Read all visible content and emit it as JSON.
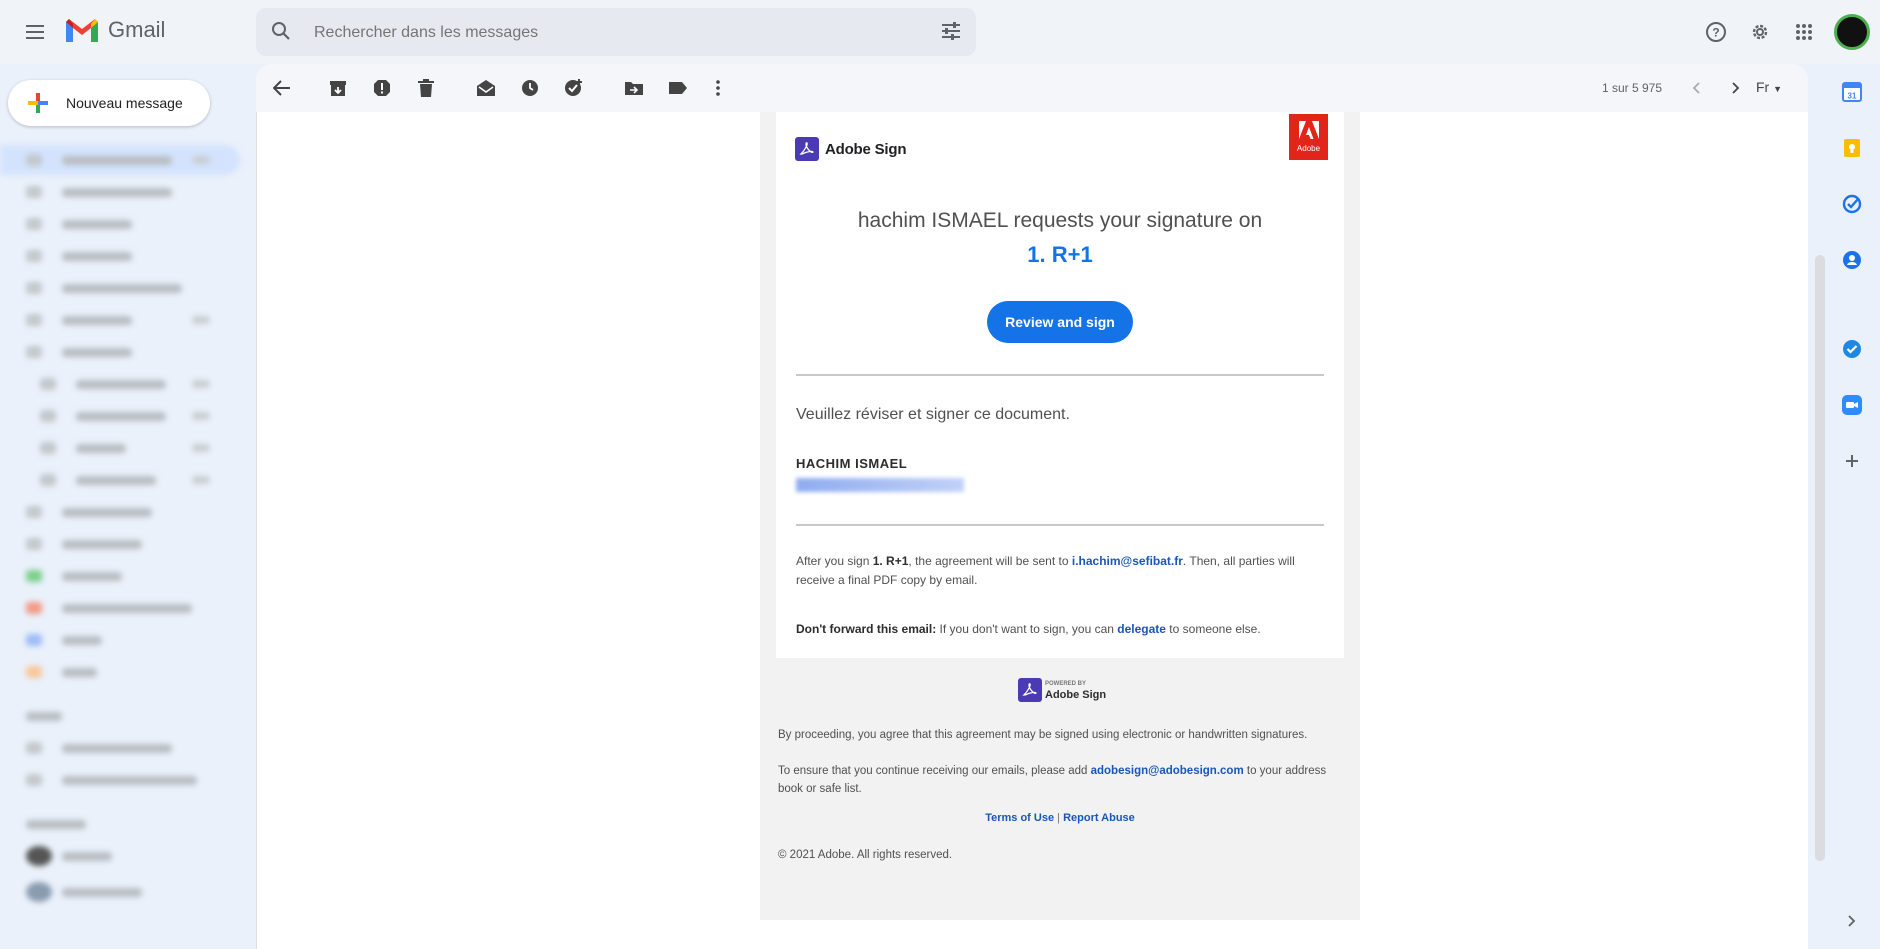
{
  "app": {
    "name": "Gmail"
  },
  "search": {
    "placeholder": "Rechercher dans les messages"
  },
  "compose": {
    "label": "Nouveau message"
  },
  "toolbar": {
    "pager": "1 sur 5 975",
    "lang": "Fr"
  },
  "email": {
    "brand": "Adobe Sign",
    "badge_text": "Adobe",
    "request_line": "hachim ISMAEL requests your signature on",
    "document_name": "1. R+1",
    "review_button": "Review and sign",
    "message": "Veuillez réviser et signer ce document.",
    "sender_name": "HACHIM ISMAEL",
    "after_prefix": "After you sign ",
    "after_doc": "1. R+1",
    "after_mid": ", the agreement will be sent to ",
    "after_email": "i.hachim@sefibat.fr",
    "after_suffix": ". Then, all parties will receive a final PDF copy by email.",
    "dont_forward_label": "Don't forward this email:",
    "dont_forward_text": " If you don't want to sign, you can ",
    "delegate_link": "delegate",
    "dont_forward_end": " to someone else."
  },
  "footer": {
    "powered_by": "POWERED BY",
    "powered_brand": "Adobe Sign",
    "consent": "By proceeding, you agree that this agreement may be signed using electronic or handwritten signatures.",
    "ensure_prefix": "To ensure that you continue receiving our emails, please add ",
    "ensure_email": "adobesign@adobesign.com",
    "ensure_suffix": " to your address book or safe list.",
    "terms": "Terms of Use",
    "separator": " | ",
    "report": "Report Abuse",
    "copyright": "© 2021 Adobe. All rights reserved."
  },
  "colors": {
    "accent": "#1473e6",
    "adobe_red": "#e1251b",
    "sign_purple": "#4a3bb5"
  }
}
